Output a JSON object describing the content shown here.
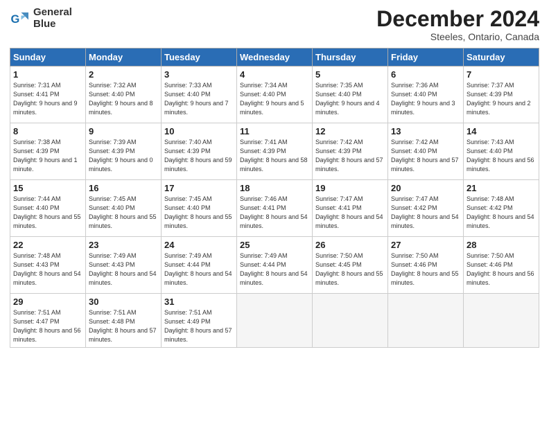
{
  "logo": {
    "line1": "General",
    "line2": "Blue"
  },
  "title": "December 2024",
  "location": "Steeles, Ontario, Canada",
  "days_of_week": [
    "Sunday",
    "Monday",
    "Tuesday",
    "Wednesday",
    "Thursday",
    "Friday",
    "Saturday"
  ],
  "weeks": [
    [
      {
        "day": "1",
        "sunrise": "Sunrise: 7:31 AM",
        "sunset": "Sunset: 4:41 PM",
        "daylight": "Daylight: 9 hours and 9 minutes."
      },
      {
        "day": "2",
        "sunrise": "Sunrise: 7:32 AM",
        "sunset": "Sunset: 4:40 PM",
        "daylight": "Daylight: 9 hours and 8 minutes."
      },
      {
        "day": "3",
        "sunrise": "Sunrise: 7:33 AM",
        "sunset": "Sunset: 4:40 PM",
        "daylight": "Daylight: 9 hours and 7 minutes."
      },
      {
        "day": "4",
        "sunrise": "Sunrise: 7:34 AM",
        "sunset": "Sunset: 4:40 PM",
        "daylight": "Daylight: 9 hours and 5 minutes."
      },
      {
        "day": "5",
        "sunrise": "Sunrise: 7:35 AM",
        "sunset": "Sunset: 4:40 PM",
        "daylight": "Daylight: 9 hours and 4 minutes."
      },
      {
        "day": "6",
        "sunrise": "Sunrise: 7:36 AM",
        "sunset": "Sunset: 4:40 PM",
        "daylight": "Daylight: 9 hours and 3 minutes."
      },
      {
        "day": "7",
        "sunrise": "Sunrise: 7:37 AM",
        "sunset": "Sunset: 4:39 PM",
        "daylight": "Daylight: 9 hours and 2 minutes."
      }
    ],
    [
      {
        "day": "8",
        "sunrise": "Sunrise: 7:38 AM",
        "sunset": "Sunset: 4:39 PM",
        "daylight": "Daylight: 9 hours and 1 minute."
      },
      {
        "day": "9",
        "sunrise": "Sunrise: 7:39 AM",
        "sunset": "Sunset: 4:39 PM",
        "daylight": "Daylight: 9 hours and 0 minutes."
      },
      {
        "day": "10",
        "sunrise": "Sunrise: 7:40 AM",
        "sunset": "Sunset: 4:39 PM",
        "daylight": "Daylight: 8 hours and 59 minutes."
      },
      {
        "day": "11",
        "sunrise": "Sunrise: 7:41 AM",
        "sunset": "Sunset: 4:39 PM",
        "daylight": "Daylight: 8 hours and 58 minutes."
      },
      {
        "day": "12",
        "sunrise": "Sunrise: 7:42 AM",
        "sunset": "Sunset: 4:39 PM",
        "daylight": "Daylight: 8 hours and 57 minutes."
      },
      {
        "day": "13",
        "sunrise": "Sunrise: 7:42 AM",
        "sunset": "Sunset: 4:40 PM",
        "daylight": "Daylight: 8 hours and 57 minutes."
      },
      {
        "day": "14",
        "sunrise": "Sunrise: 7:43 AM",
        "sunset": "Sunset: 4:40 PM",
        "daylight": "Daylight: 8 hours and 56 minutes."
      }
    ],
    [
      {
        "day": "15",
        "sunrise": "Sunrise: 7:44 AM",
        "sunset": "Sunset: 4:40 PM",
        "daylight": "Daylight: 8 hours and 55 minutes."
      },
      {
        "day": "16",
        "sunrise": "Sunrise: 7:45 AM",
        "sunset": "Sunset: 4:40 PM",
        "daylight": "Daylight: 8 hours and 55 minutes."
      },
      {
        "day": "17",
        "sunrise": "Sunrise: 7:45 AM",
        "sunset": "Sunset: 4:40 PM",
        "daylight": "Daylight: 8 hours and 55 minutes."
      },
      {
        "day": "18",
        "sunrise": "Sunrise: 7:46 AM",
        "sunset": "Sunset: 4:41 PM",
        "daylight": "Daylight: 8 hours and 54 minutes."
      },
      {
        "day": "19",
        "sunrise": "Sunrise: 7:47 AM",
        "sunset": "Sunset: 4:41 PM",
        "daylight": "Daylight: 8 hours and 54 minutes."
      },
      {
        "day": "20",
        "sunrise": "Sunrise: 7:47 AM",
        "sunset": "Sunset: 4:42 PM",
        "daylight": "Daylight: 8 hours and 54 minutes."
      },
      {
        "day": "21",
        "sunrise": "Sunrise: 7:48 AM",
        "sunset": "Sunset: 4:42 PM",
        "daylight": "Daylight: 8 hours and 54 minutes."
      }
    ],
    [
      {
        "day": "22",
        "sunrise": "Sunrise: 7:48 AM",
        "sunset": "Sunset: 4:43 PM",
        "daylight": "Daylight: 8 hours and 54 minutes."
      },
      {
        "day": "23",
        "sunrise": "Sunrise: 7:49 AM",
        "sunset": "Sunset: 4:43 PM",
        "daylight": "Daylight: 8 hours and 54 minutes."
      },
      {
        "day": "24",
        "sunrise": "Sunrise: 7:49 AM",
        "sunset": "Sunset: 4:44 PM",
        "daylight": "Daylight: 8 hours and 54 minutes."
      },
      {
        "day": "25",
        "sunrise": "Sunrise: 7:49 AM",
        "sunset": "Sunset: 4:44 PM",
        "daylight": "Daylight: 8 hours and 54 minutes."
      },
      {
        "day": "26",
        "sunrise": "Sunrise: 7:50 AM",
        "sunset": "Sunset: 4:45 PM",
        "daylight": "Daylight: 8 hours and 55 minutes."
      },
      {
        "day": "27",
        "sunrise": "Sunrise: 7:50 AM",
        "sunset": "Sunset: 4:46 PM",
        "daylight": "Daylight: 8 hours and 55 minutes."
      },
      {
        "day": "28",
        "sunrise": "Sunrise: 7:50 AM",
        "sunset": "Sunset: 4:46 PM",
        "daylight": "Daylight: 8 hours and 56 minutes."
      }
    ],
    [
      {
        "day": "29",
        "sunrise": "Sunrise: 7:51 AM",
        "sunset": "Sunset: 4:47 PM",
        "daylight": "Daylight: 8 hours and 56 minutes."
      },
      {
        "day": "30",
        "sunrise": "Sunrise: 7:51 AM",
        "sunset": "Sunset: 4:48 PM",
        "daylight": "Daylight: 8 hours and 57 minutes."
      },
      {
        "day": "31",
        "sunrise": "Sunrise: 7:51 AM",
        "sunset": "Sunset: 4:49 PM",
        "daylight": "Daylight: 8 hours and 57 minutes."
      },
      null,
      null,
      null,
      null
    ]
  ]
}
